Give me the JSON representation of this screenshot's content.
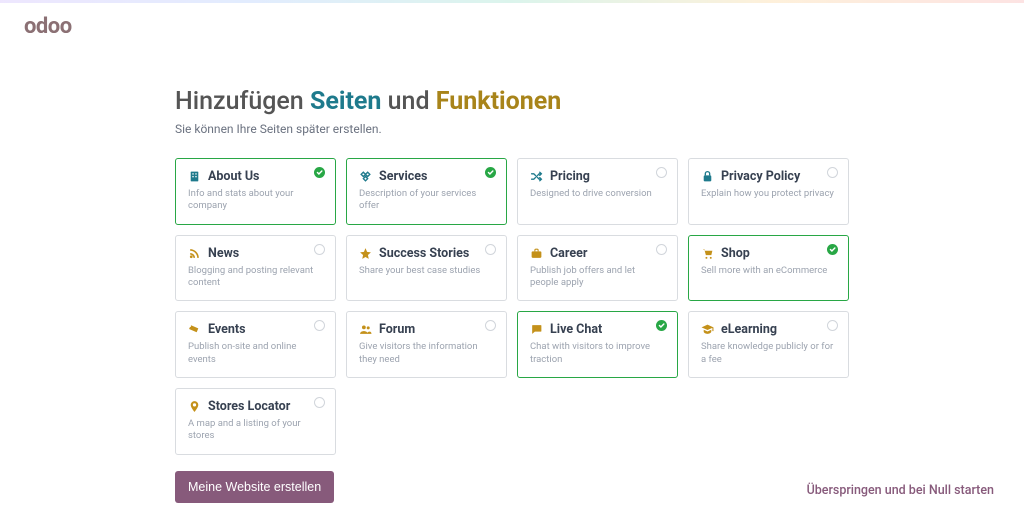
{
  "logo": "odoo",
  "heading": {
    "part1": "Hinzufügen ",
    "part2": "Seiten",
    "part3": " und ",
    "part4": "Funktionen"
  },
  "subtitle": "Sie können Ihre Seiten später erstellen.",
  "cards": [
    {
      "title": "About Us",
      "desc": "Info and stats about your company",
      "icon": "building-icon",
      "color": "teal",
      "selected": true
    },
    {
      "title": "Services",
      "desc": "Description of your services offer",
      "icon": "offer-icon",
      "color": "teal",
      "selected": true
    },
    {
      "title": "Pricing",
      "desc": "Designed to drive conversion",
      "icon": "shuffle-icon",
      "color": "teal",
      "selected": false
    },
    {
      "title": "Privacy Policy",
      "desc": "Explain how you protect privacy",
      "icon": "lock-icon",
      "color": "teal",
      "selected": false
    },
    {
      "title": "News",
      "desc": "Blogging and posting relevant content",
      "icon": "rss-icon",
      "color": "gold",
      "selected": false
    },
    {
      "title": "Success Stories",
      "desc": "Share your best case studies",
      "icon": "star-icon",
      "color": "gold",
      "selected": false
    },
    {
      "title": "Career",
      "desc": "Publish job offers and let people apply",
      "icon": "briefcase-icon",
      "color": "gold",
      "selected": false
    },
    {
      "title": "Shop",
      "desc": "Sell more with an eCommerce",
      "icon": "cart-icon",
      "color": "gold",
      "selected": true
    },
    {
      "title": "Events",
      "desc": "Publish on-site and online events",
      "icon": "ticket-icon",
      "color": "gold",
      "selected": false
    },
    {
      "title": "Forum",
      "desc": "Give visitors the information they need",
      "icon": "users-icon",
      "color": "gold",
      "selected": false
    },
    {
      "title": "Live Chat",
      "desc": "Chat with visitors to improve traction",
      "icon": "chat-icon",
      "color": "gold",
      "selected": true
    },
    {
      "title": "eLearning",
      "desc": "Share knowledge publicly or for a fee",
      "icon": "graduation-icon",
      "color": "gold",
      "selected": false
    },
    {
      "title": "Stores Locator",
      "desc": "A map and a listing of your stores",
      "icon": "pin-icon",
      "color": "gold",
      "selected": false
    }
  ],
  "primary_btn": "Meine Website erstellen",
  "skip_link": "Überspringen und bei Null starten"
}
